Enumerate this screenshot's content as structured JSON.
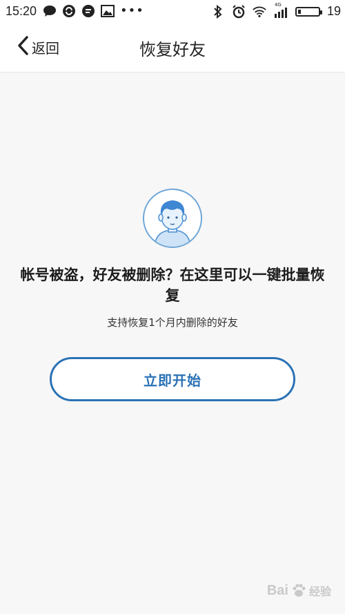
{
  "status_bar": {
    "time": "15:20",
    "network": "4G",
    "battery_level": "19"
  },
  "header": {
    "back_label": "返回",
    "title": "恢复好友"
  },
  "main": {
    "headline": "帐号被盗，好友被删除？在这里可以一键批量恢复",
    "subtext": "支持恢复1个月内删除的好友",
    "start_button_label": "立即开始"
  },
  "watermark": {
    "brand": "Bai",
    "brand_suffix": "经验"
  },
  "colors": {
    "accent": "#2a72b5",
    "background": "#f7f7f7"
  }
}
